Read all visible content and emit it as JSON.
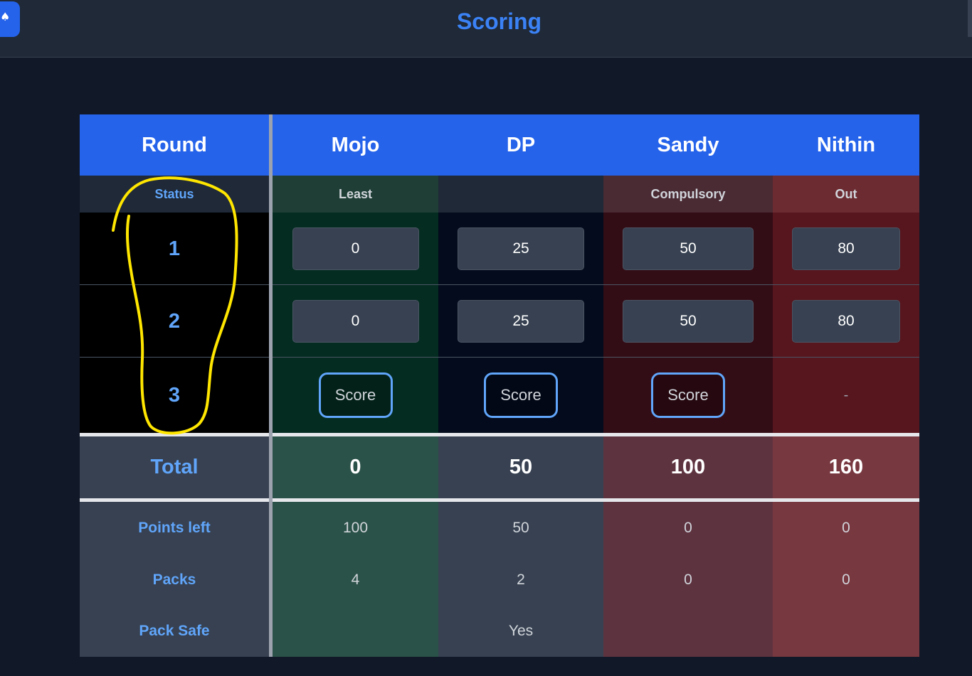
{
  "header": {
    "title": "Scoring",
    "app_icon": "spade-icon"
  },
  "table": {
    "round_label": "Round",
    "status_label": "Status",
    "total_label": "Total",
    "players": [
      {
        "name": "Mojo",
        "status": "Least",
        "scores": [
          "0",
          "0"
        ],
        "score_button": "Score",
        "total": "0",
        "points_left": "100",
        "packs": "4",
        "pack_safe": ""
      },
      {
        "name": "DP",
        "status": "",
        "scores": [
          "25",
          "25"
        ],
        "score_button": "Score",
        "total": "50",
        "points_left": "50",
        "packs": "2",
        "pack_safe": "Yes"
      },
      {
        "name": "Sandy",
        "status": "Compulsory",
        "scores": [
          "50",
          "50"
        ],
        "score_button": "Score",
        "total": "100",
        "points_left": "0",
        "packs": "0",
        "pack_safe": ""
      },
      {
        "name": "Nithin",
        "status": "Out",
        "scores": [
          "80",
          "80"
        ],
        "score_button": "-",
        "total": "160",
        "points_left": "0",
        "packs": "0",
        "pack_safe": ""
      }
    ],
    "rounds": [
      "1",
      "2",
      "3"
    ],
    "stats": {
      "points_left_label": "Points left",
      "packs_label": "Packs",
      "pack_safe_label": "Pack Safe"
    }
  },
  "colors": {
    "accent": "#2563eb",
    "title": "#3b82f6",
    "label": "#60a5fa",
    "annotation": "#ffe600",
    "least": "#2b5248",
    "neutral": "#374151",
    "compulsory": "#5e3340",
    "out": "#783840"
  }
}
